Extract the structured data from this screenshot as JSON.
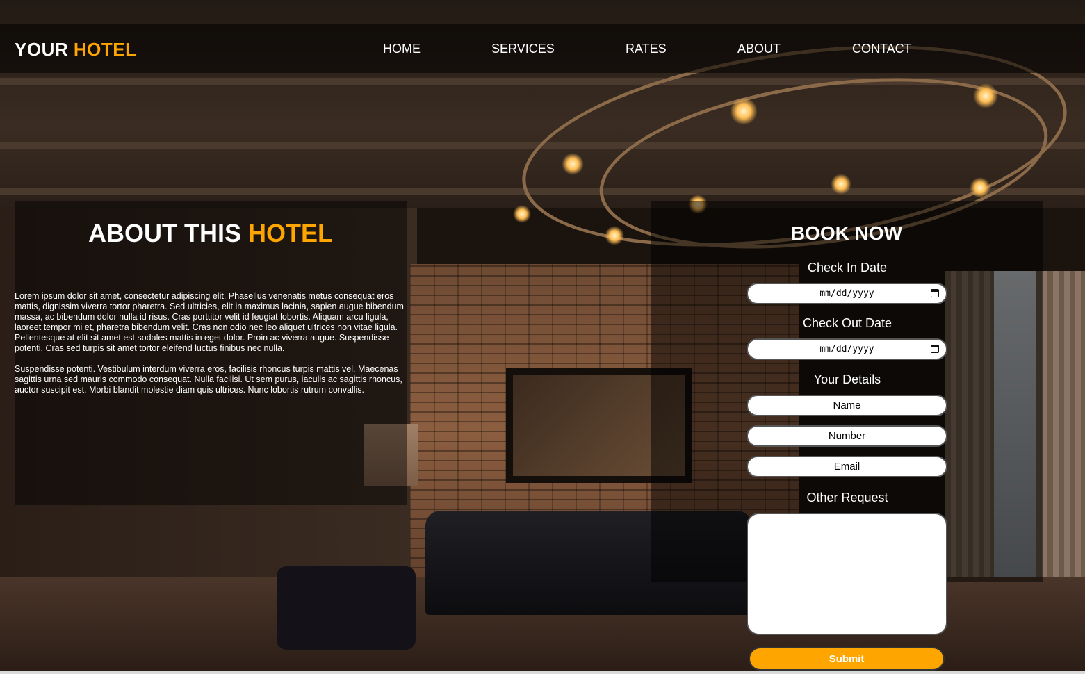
{
  "brand": {
    "part1": "YOUR",
    "part2": "HOTEL"
  },
  "nav": [
    "HOME",
    "SERVICES",
    "RATES",
    "ABOUT",
    "CONTACT"
  ],
  "about": {
    "title_part1": "ABOUT THIS",
    "title_part2": "HOTEL",
    "paragraphs": [
      "Lorem ipsum dolor sit amet, consectetur adipiscing elit. Phasellus venenatis metus consequat eros mattis, dignissim viverra tortor pharetra. Sed ultricies, elit in maximus lacinia, sapien augue bibendum massa, ac bibendum dolor nulla id risus. Cras porttitor velit id feugiat lobortis. Aliquam arcu ligula, laoreet tempor mi et, pharetra bibendum velit. Cras non odio nec leo aliquet ultrices non vitae ligula. Pellentesque at elit sit amet est sodales mattis in eget dolor. Proin ac viverra augue. Suspendisse potenti. Cras sed turpis sit amet tortor eleifend luctus finibus nec nulla.",
      "Suspendisse potenti. Vestibulum interdum viverra eros, facilisis rhoncus turpis mattis vel. Maecenas sagittis urna sed mauris commodo consequat. Nulla facilisi. Ut sem purus, iaculis ac sagittis rhoncus, auctor suscipit est. Morbi blandit molestie diam quis ultrices. Nunc lobortis rutrum convallis."
    ]
  },
  "booking": {
    "title": "BOOK NOW",
    "check_in_label": "Check In Date",
    "check_in_value": "mm/dd/yyyy",
    "check_out_label": "Check Out Date",
    "check_out_value": "mm/dd/yyyy",
    "details_label": "Your Details",
    "name_placeholder": "Name",
    "number_placeholder": "Number",
    "email_placeholder": "Email",
    "request_label": "Other Request",
    "submit_label": "Submit"
  },
  "colors": {
    "accent": "#ffa500",
    "text": "#ffffff"
  },
  "icons": {
    "date_picker": "calendar-icon"
  }
}
